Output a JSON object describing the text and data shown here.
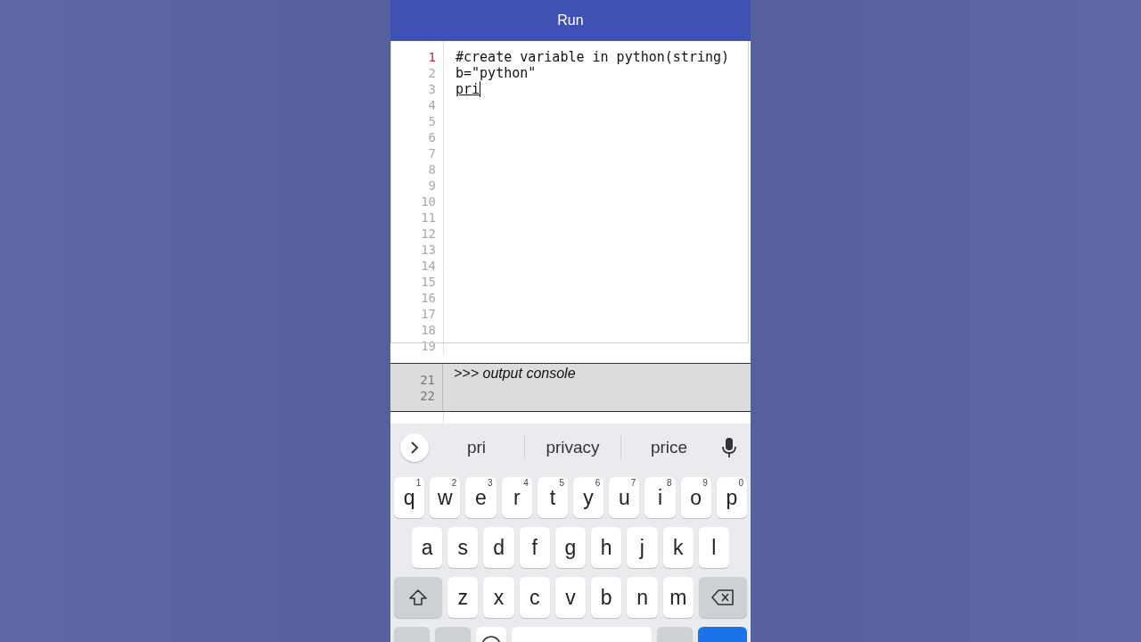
{
  "header": {
    "title": "Run"
  },
  "editor": {
    "line_numbers": [
      {
        "text": "1",
        "current": true
      },
      {
        "text": "2",
        "current": false
      },
      {
        "text": "3",
        "current": false
      },
      {
        "text": "4",
        "current": false
      },
      {
        "text": "5",
        "current": false
      },
      {
        "text": "6",
        "current": false
      },
      {
        "text": "7",
        "current": false
      },
      {
        "text": "8",
        "current": false
      },
      {
        "text": "9",
        "current": false
      },
      {
        "text": "10",
        "current": false
      },
      {
        "text": "11",
        "current": false
      },
      {
        "text": "12",
        "current": false
      },
      {
        "text": "13",
        "current": false
      },
      {
        "text": "14",
        "current": false
      },
      {
        "text": "15",
        "current": false
      },
      {
        "text": "16",
        "current": false
      },
      {
        "text": "17",
        "current": false
      },
      {
        "text": "18",
        "current": false
      },
      {
        "text": "19",
        "current": false
      }
    ],
    "lines": [
      {
        "text": "#create variable in python(string)",
        "composing": false
      },
      {
        "text": "b=\"python\"",
        "composing": false
      },
      {
        "text": "pri",
        "composing": true
      }
    ]
  },
  "console": {
    "line_numbers": [
      "21",
      "22"
    ],
    "text": ">>> output console"
  },
  "keyboard": {
    "suggestions": [
      "pri",
      "privacy",
      "price"
    ],
    "rows": [
      [
        {
          "kind": "letter",
          "label": "q",
          "hint": "1"
        },
        {
          "kind": "letter",
          "label": "w",
          "hint": "2"
        },
        {
          "kind": "letter",
          "label": "e",
          "hint": "3"
        },
        {
          "kind": "letter",
          "label": "r",
          "hint": "4"
        },
        {
          "kind": "letter",
          "label": "t",
          "hint": "5"
        },
        {
          "kind": "letter",
          "label": "y",
          "hint": "6"
        },
        {
          "kind": "letter",
          "label": "u",
          "hint": "7"
        },
        {
          "kind": "letter",
          "label": "i",
          "hint": "8"
        },
        {
          "kind": "letter",
          "label": "o",
          "hint": "9"
        },
        {
          "kind": "letter",
          "label": "p",
          "hint": "0"
        }
      ],
      [
        {
          "kind": "letter",
          "label": "a"
        },
        {
          "kind": "letter",
          "label": "s"
        },
        {
          "kind": "letter",
          "label": "d"
        },
        {
          "kind": "letter",
          "label": "f"
        },
        {
          "kind": "letter",
          "label": "g"
        },
        {
          "kind": "letter",
          "label": "h"
        },
        {
          "kind": "letter",
          "label": "j"
        },
        {
          "kind": "letter",
          "label": "k"
        },
        {
          "kind": "letter",
          "label": "l"
        }
      ],
      [
        {
          "kind": "shift"
        },
        {
          "kind": "letter",
          "label": "z"
        },
        {
          "kind": "letter",
          "label": "x"
        },
        {
          "kind": "letter",
          "label": "c"
        },
        {
          "kind": "letter",
          "label": "v"
        },
        {
          "kind": "letter",
          "label": "b"
        },
        {
          "kind": "letter",
          "label": "n"
        },
        {
          "kind": "letter",
          "label": "m"
        },
        {
          "kind": "backspace"
        }
      ],
      [
        {
          "kind": "function"
        },
        {
          "kind": "function"
        },
        {
          "kind": "emoji"
        },
        {
          "kind": "space"
        },
        {
          "kind": "function"
        },
        {
          "kind": "action"
        }
      ]
    ]
  }
}
